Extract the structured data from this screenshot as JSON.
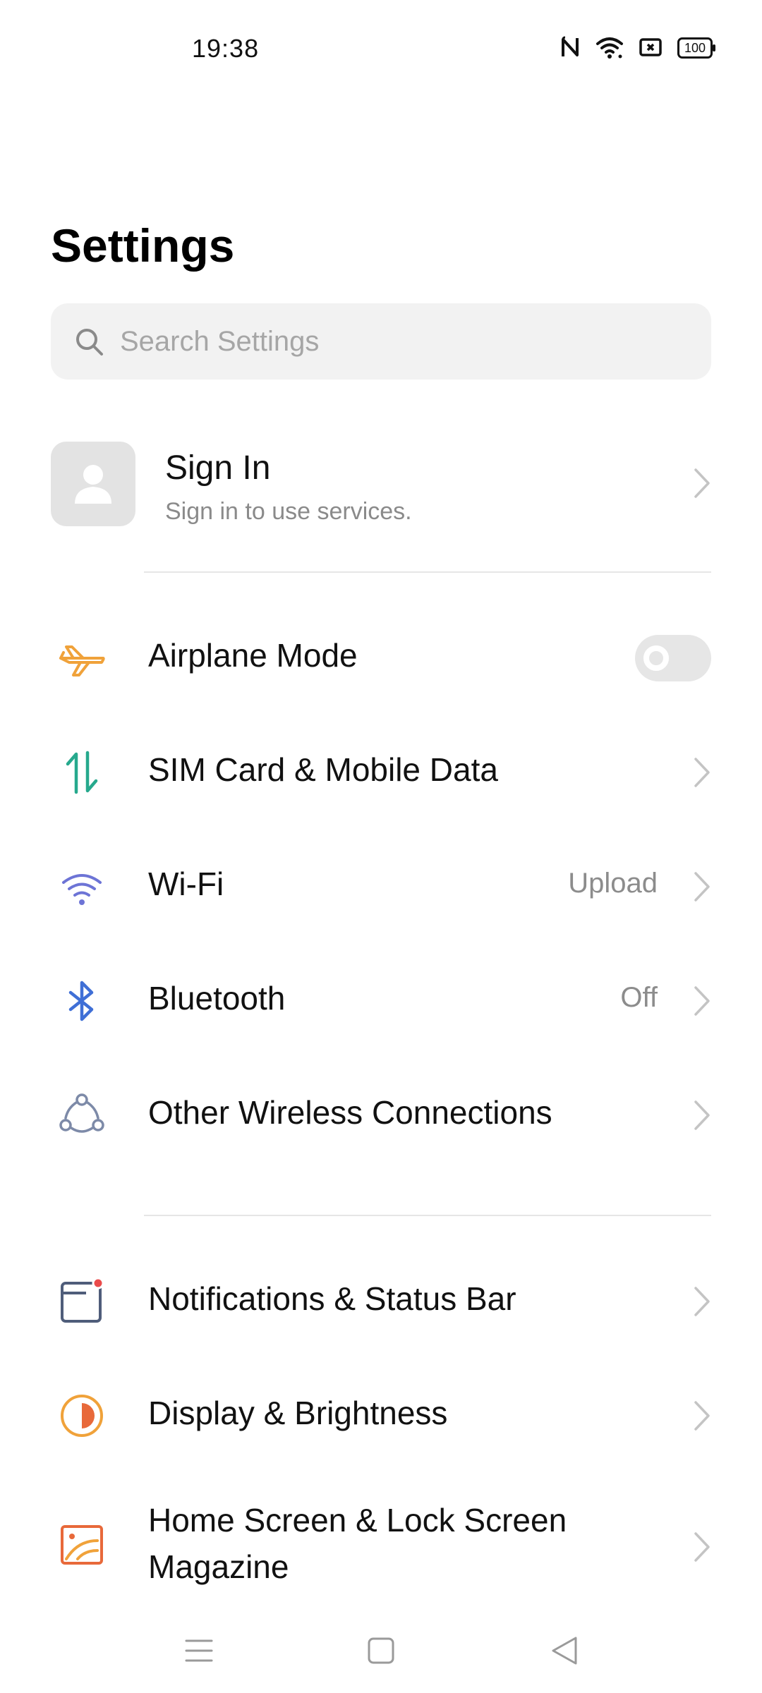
{
  "status_bar": {
    "time": "19:38",
    "battery": "100",
    "icons": [
      "nfc-icon",
      "wifi-icon",
      "no-sim-icon",
      "battery-icon"
    ]
  },
  "page": {
    "title": "Settings"
  },
  "search": {
    "placeholder": "Search Settings"
  },
  "account": {
    "title": "Sign In",
    "subtitle": "Sign in to use services."
  },
  "items": [
    {
      "label": "Airplane Mode",
      "icon": "airplane-icon",
      "toggle": false
    },
    {
      "label": "SIM Card & Mobile Data",
      "icon": "mobile-data-icon"
    },
    {
      "label": "Wi-Fi",
      "icon": "wifi-icon",
      "value": "Upload"
    },
    {
      "label": "Bluetooth",
      "icon": "bluetooth-icon",
      "value": "Off"
    },
    {
      "label": "Other Wireless Connections",
      "icon": "wireless-connections-icon"
    },
    {
      "label": "Notifications & Status Bar",
      "icon": "notifications-icon"
    },
    {
      "label": "Display & Brightness",
      "icon": "display-brightness-icon"
    },
    {
      "label": "Home Screen & Lock Screen Magazine",
      "icon": "home-screen-icon"
    }
  ],
  "colors": {
    "airplane": "#f0a23a",
    "mobile_data": "#26a98d",
    "wifi": "#6d74d6",
    "bluetooth": "#3f6fd6",
    "wireless": "#7d8aa8",
    "notifications": "#4f5d7a",
    "notification_dot": "#ea4b4b",
    "display": "#f0a23a",
    "home_screen": "#e8693a"
  },
  "navbar": {
    "icons": [
      "menu-icon",
      "home-icon",
      "back-icon"
    ]
  }
}
